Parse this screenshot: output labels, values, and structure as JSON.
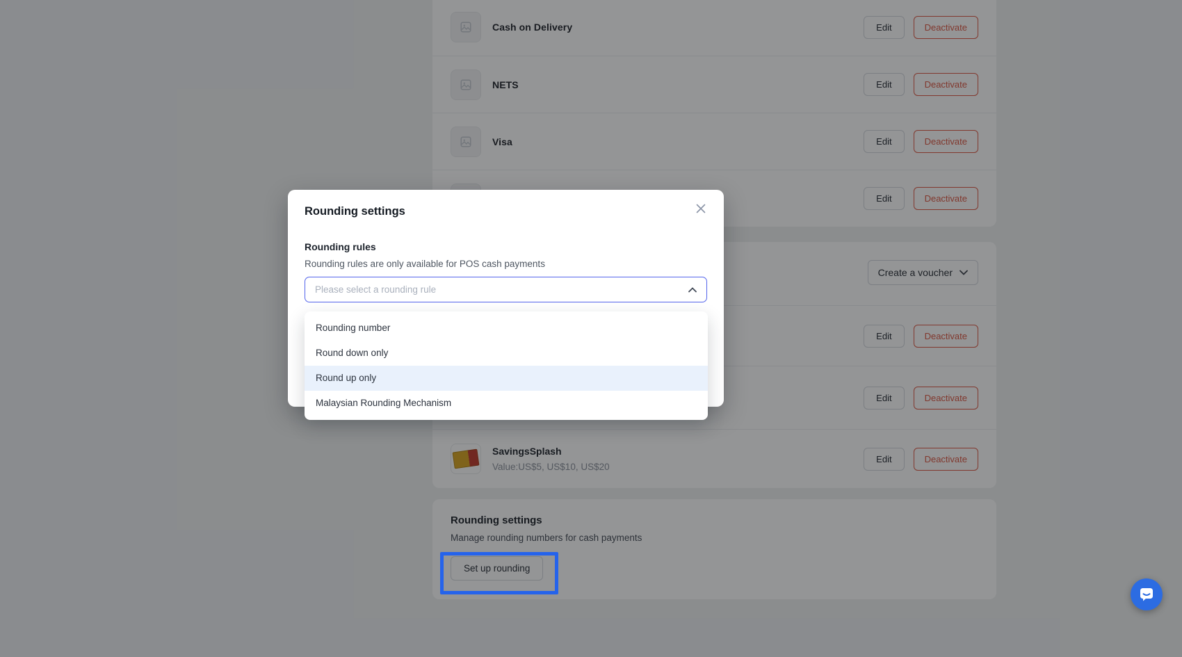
{
  "labels": {
    "edit": "Edit",
    "deactivate": "Deactivate"
  },
  "payment_methods": {
    "rows": [
      {
        "name": "Cash on Delivery"
      },
      {
        "name": "NETS"
      },
      {
        "name": "Visa"
      },
      {
        "name": ""
      }
    ]
  },
  "vouchers": {
    "create_button_label": "Create a voucher",
    "rows": [
      {
        "name": "",
        "value": ""
      },
      {
        "name": "",
        "value": ""
      },
      {
        "name": "SavingsSplash",
        "value": "Value:US$5, US$10, US$20"
      }
    ]
  },
  "rounding_card": {
    "title": "Rounding settings",
    "description": "Manage rounding numbers for cash payments",
    "button_label": "Set up rounding"
  },
  "modal": {
    "title": "Rounding settings",
    "rules_label": "Rounding rules",
    "rules_description": "Rounding rules are only available for POS cash payments",
    "select_placeholder": "Please select a rounding rule",
    "options": [
      {
        "label": "Rounding number"
      },
      {
        "label": "Round down only"
      },
      {
        "label": "Round up only",
        "highlighted": true
      },
      {
        "label": "Malaysian Rounding Mechanism"
      }
    ]
  },
  "colors": {
    "select_border": "#5263eb",
    "option_highlight_bg": "#e9f1fc",
    "deactivate_red": "#dc5742",
    "annotation_blue": "#2563eb",
    "chat_launcher_blue": "#2c6ce2"
  }
}
